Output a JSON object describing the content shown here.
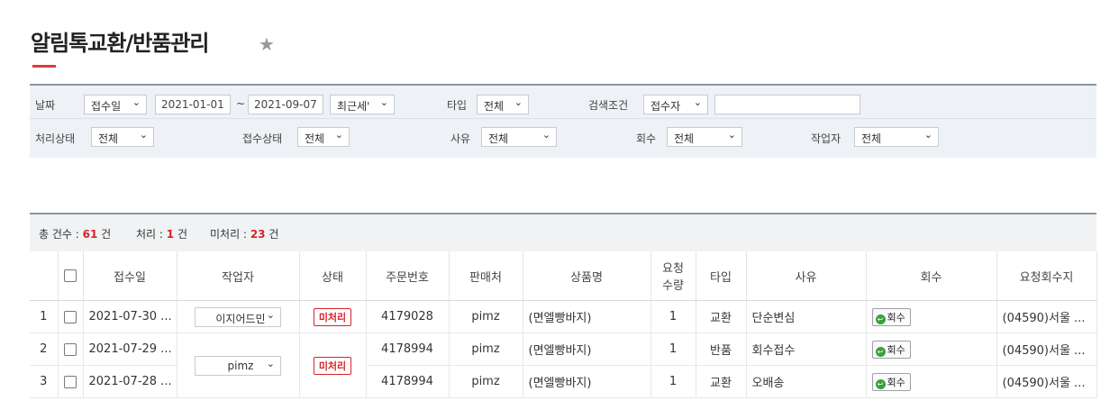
{
  "page": {
    "title": "알림톡교환/반품관리"
  },
  "filters": {
    "row1": {
      "date_label": "날짜",
      "date_type": "접수일",
      "date_from": "2021-01-01",
      "tilde": "~",
      "date_to": "2021-09-07",
      "period": "최근세'",
      "type_label": "타입",
      "type_value": "전체",
      "search_label": "검색조건",
      "search_field": "접수자",
      "search_value": ""
    },
    "row2": {
      "process_label": "처리상태",
      "process_value": "전체",
      "receipt_label": "접수상태",
      "receipt_value": "전체",
      "reason_label": "사유",
      "reason_value": "전체",
      "pickup_label": "회수",
      "pickup_value": "전체",
      "worker_label": "작업자",
      "worker_value": "전체"
    }
  },
  "summary": {
    "total_label": "총 건수 :",
    "total_count": "61",
    "total_unit": "건",
    "done_label": "처리 :",
    "done_count": "1",
    "done_unit": "건",
    "pending_label": "미처리 :",
    "pending_count": "23",
    "pending_unit": "건"
  },
  "table": {
    "headers": [
      "접수일",
      "작업자",
      "상태",
      "주문번호",
      "판매처",
      "상품명",
      "요청수량",
      "타입",
      "사유",
      "회수",
      "요청회수지"
    ],
    "qty_header_line1": "요청",
    "qty_header_line2": "수량",
    "rows": [
      {
        "no": "1",
        "date": "2021-07-30 ...",
        "worker": "이지어드민",
        "status": "미처리",
        "order": "4179028",
        "seller": "pimz",
        "product": "(면엘빵바지)",
        "qty": "1",
        "type": "교환",
        "reason": "단순변심",
        "pickup": "회수",
        "address": "(04590)서울 ..."
      },
      {
        "no": "2",
        "date": "2021-07-29 ...",
        "worker": "pimz",
        "status": "미처리",
        "order": "4178994",
        "seller": "pimz",
        "product": "(면엘빵바지)",
        "qty": "1",
        "type": "반품",
        "reason": "회수접수",
        "pickup": "회수",
        "address": "(04590)서울 ..."
      },
      {
        "no": "3",
        "date": "2021-07-28 ...",
        "worker": "",
        "status": "",
        "order": "4178994",
        "seller": "pimz",
        "product": "(면엘빵바지)",
        "qty": "1",
        "type": "교환",
        "reason": "오배송",
        "pickup": "회수",
        "address": "(04590)서울 ..."
      }
    ]
  },
  "colors": {
    "accent": "#d8232a",
    "header_line": "#8a96a3",
    "filter_bg": "#eef1f5",
    "pickup_icon": "#3aa03a"
  }
}
